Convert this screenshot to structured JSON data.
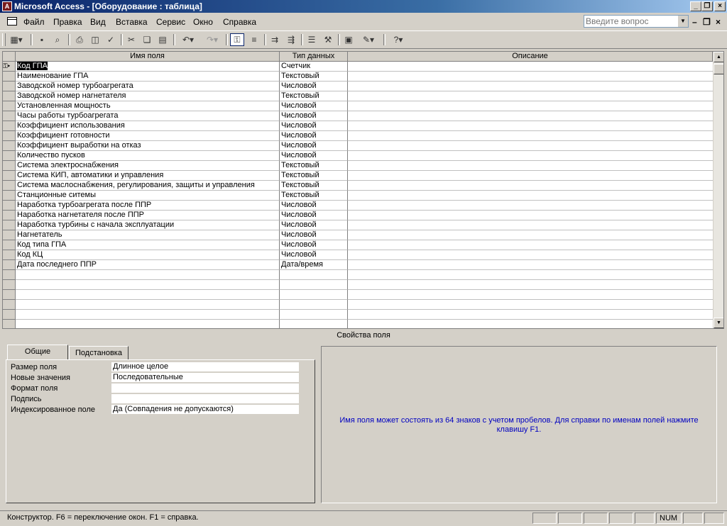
{
  "window": {
    "title": "Microsoft Access - [Оборудование : таблица]",
    "app_icon": "access-key-icon"
  },
  "menu": {
    "items": [
      "Файл",
      "Правка",
      "Вид",
      "Вставка",
      "Сервис",
      "Окно",
      "Справка"
    ]
  },
  "ask": {
    "placeholder": "Введите вопрос"
  },
  "grid": {
    "headers": {
      "name": "Имя поля",
      "type": "Тип данных",
      "desc": "Описание"
    },
    "rows": [
      {
        "name": "Код ГПА",
        "type": "Счетчик",
        "key": true
      },
      {
        "name": "Наименование  ГПА",
        "type": "Текстовый"
      },
      {
        "name": "Заводской номер турбоагрегата",
        "type": "Числовой"
      },
      {
        "name": "Заводской номер нагнетателя",
        "type": "Текстовый"
      },
      {
        "name": "Установленная мощность",
        "type": "Числовой"
      },
      {
        "name": "Часы работы турбоагрегата",
        "type": "Числовой"
      },
      {
        "name": "Коэффициент использования",
        "type": "Числовой"
      },
      {
        "name": "Коэффициент готовности",
        "type": "Числовой"
      },
      {
        "name": "Коэффициент выработки на отказ",
        "type": "Числовой"
      },
      {
        "name": "Количество пусков",
        "type": "Числовой"
      },
      {
        "name": "Система электроснабжения",
        "type": "Текстовый"
      },
      {
        "name": "Система КИП, автоматики и управления",
        "type": "Текстовый"
      },
      {
        "name": "Система маслоснабжения, регулирования, защиты и управления",
        "type": "Текстовый"
      },
      {
        "name": "Станционные ситемы",
        "type": "Текстовый"
      },
      {
        "name": "Наработка турбоагрегата после ППР",
        "type": "Числовой"
      },
      {
        "name": "Наработка нагнетателя после ППР",
        "type": "Числовой"
      },
      {
        "name": "Наработка турбины с начала эксплуатации",
        "type": "Числовой"
      },
      {
        "name": "Нагнетатель",
        "type": "Числовой"
      },
      {
        "name": "Код типа ГПА",
        "type": "Числовой"
      },
      {
        "name": "Код КЦ",
        "type": "Числовой"
      },
      {
        "name": "Дата последнего ППР",
        "type": "Дата/время"
      }
    ]
  },
  "props": {
    "title": "Свойства поля",
    "tabs": [
      "Общие",
      "Подстановка"
    ],
    "fields": [
      {
        "label": "Размер поля",
        "value": "Длинное целое"
      },
      {
        "label": "Новые значения",
        "value": "Последовательные"
      },
      {
        "label": "Формат поля",
        "value": ""
      },
      {
        "label": "Подпись",
        "value": ""
      },
      {
        "label": "Индексированное поле",
        "value": "Да (Совпадения не допускаются)"
      }
    ],
    "help": "Имя поля может состоять из 64 знаков с учетом пробелов.  Для справки по именам полей нажмите клавишу F1."
  },
  "status": {
    "text": "Конструктор.  F6 = переключение окон.  F1 = справка.",
    "num": "NUM"
  }
}
